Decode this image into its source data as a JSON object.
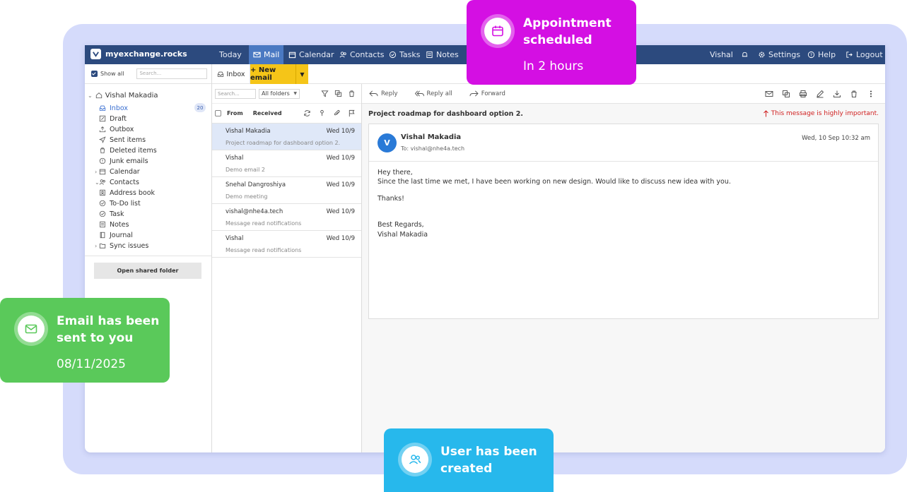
{
  "app": {
    "brand": "myexchange.rocks"
  },
  "nav": {
    "items": [
      "Today",
      "Mail",
      "Calendar",
      "Contacts",
      "Tasks",
      "Notes"
    ],
    "active": "Mail",
    "user": "Vishal",
    "settings": "Settings",
    "help": "Help",
    "logout": "Logout"
  },
  "sidebar": {
    "show_all": "Show all",
    "search_placeholder": "Search...",
    "account": "Vishal Makadia",
    "folders": [
      {
        "label": "Inbox",
        "icon": "inbox-icon",
        "badge": "20",
        "active": true
      },
      {
        "label": "Draft",
        "icon": "edit-icon"
      },
      {
        "label": "Outbox",
        "icon": "upload-icon"
      },
      {
        "label": "Sent items",
        "icon": "send-icon"
      },
      {
        "label": "Deleted items",
        "icon": "trash-icon"
      },
      {
        "label": "Junk emails",
        "icon": "alert-icon"
      },
      {
        "label": "Calendar",
        "icon": "calendar-icon"
      },
      {
        "label": "Contacts",
        "icon": "contacts-icon"
      },
      {
        "label": "Address book",
        "icon": "address-book-icon"
      },
      {
        "label": "To-Do list",
        "icon": "check-circle-icon"
      },
      {
        "label": "Task",
        "icon": "check-circle-icon"
      },
      {
        "label": "Notes",
        "icon": "note-icon"
      },
      {
        "label": "Journal",
        "icon": "journal-icon"
      },
      {
        "label": "Sync issues",
        "icon": "folder-icon"
      }
    ],
    "open_shared": "Open shared folder"
  },
  "tabs": {
    "inbox": "Inbox",
    "new_email": "+ New email"
  },
  "list": {
    "search_placeholder": "Search...",
    "folder_filter": "All folders",
    "col_from": "From",
    "col_received": "Received",
    "messages": [
      {
        "from": "Vishal Makadia",
        "date": "Wed 10/9",
        "subject": "Project roadmap for dashboard option 2.",
        "selected": true
      },
      {
        "from": "Vishal",
        "date": "Wed 10/9",
        "subject": "Demo email 2"
      },
      {
        "from": "Snehal Dangroshiya",
        "date": "Wed 10/9",
        "subject": "Demo meeting"
      },
      {
        "from": "vishal@nhe4a.tech",
        "date": "Wed 10/9",
        "subject": "Message read notifications"
      },
      {
        "from": "Vishal",
        "date": "Wed 10/9",
        "subject": "Message read notifications"
      }
    ]
  },
  "reader": {
    "reply": "Reply",
    "reply_all": "Reply all",
    "forward": "Forward",
    "subject": "Project roadmap for dashboard option 2.",
    "importance": "This message is highly important.",
    "avatar_letter": "V",
    "sender": "Vishal Makadia",
    "to": "To: vishal@nhe4a.tech",
    "date": "Wed, 10 Sep 10:32 am",
    "body": [
      "Hey there,",
      "Since the last time we met, I have been working on new design. Would like to discuss new idea with you.",
      "Thanks!",
      "Best Regards,",
      "Vishal Makadia"
    ]
  },
  "toasts": {
    "appointment": {
      "title_line1": "Appointment",
      "title_line2": "scheduled",
      "detail": "In 2 hours",
      "color": "#d40fe3"
    },
    "email": {
      "title_line1": "Email has been",
      "title_line2": "sent to you",
      "detail": "08/11/2025",
      "color": "#5ac95a"
    },
    "user": {
      "title_line1": "User has been",
      "title_line2": "created",
      "color": "#27b8ec"
    }
  },
  "colors": {
    "nav": "#2c4a7e",
    "nav_active": "#4a79c2",
    "new_email": "#f5c518",
    "backdrop": "#d5dbfb",
    "important": "#d02020"
  }
}
